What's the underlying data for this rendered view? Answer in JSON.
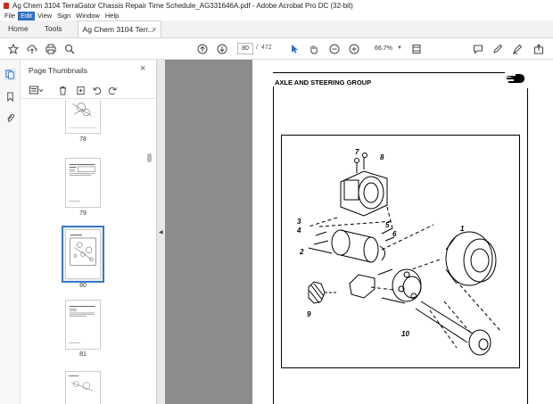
{
  "window": {
    "title": "Ag Chem 3104 TerraGator Chassis Repair Time Schedule_AG331646A.pdf - Adobe Acrobat Pro DC (32-bit)"
  },
  "menu": {
    "items": [
      "File",
      "Edit",
      "View",
      "Sign",
      "Window",
      "Help"
    ],
    "active": "Edit"
  },
  "tabs": {
    "home": "Home",
    "tools": "Tools",
    "document": "Ag Chem 3104 Terr...",
    "close": "×"
  },
  "toolbar": {
    "current_page": "80",
    "separator": "/",
    "total_pages": "472",
    "zoom": "66.7%",
    "icons": [
      "star-icon",
      "upload-icon",
      "print-icon",
      "search-icon",
      "page-up-icon",
      "page-down-icon",
      "select-cursor-icon",
      "hand-tool-icon",
      "zoom-out-icon",
      "zoom-in-icon",
      "fit-page-icon",
      "comment-icon",
      "pen-icon",
      "highlight-icon",
      "share-icon"
    ]
  },
  "thumbnails_panel": {
    "title": "Page Thumbnails",
    "close": "×",
    "pages": [
      {
        "label": "78"
      },
      {
        "label": "79"
      },
      {
        "label": "80",
        "selected": true
      },
      {
        "label": "81"
      },
      {
        "label": ""
      }
    ]
  },
  "document": {
    "section_title": "AXLE AND STEERING GROUP",
    "callouts": [
      "7",
      "8",
      "3",
      "4",
      "5",
      "6",
      "2",
      "1",
      "9",
      "10"
    ]
  },
  "colors": {
    "accent": "#2f6fc5",
    "selection": "#3b78c8",
    "doc_background": "#8b8b8b",
    "acrobat_red": "#d4261c"
  }
}
